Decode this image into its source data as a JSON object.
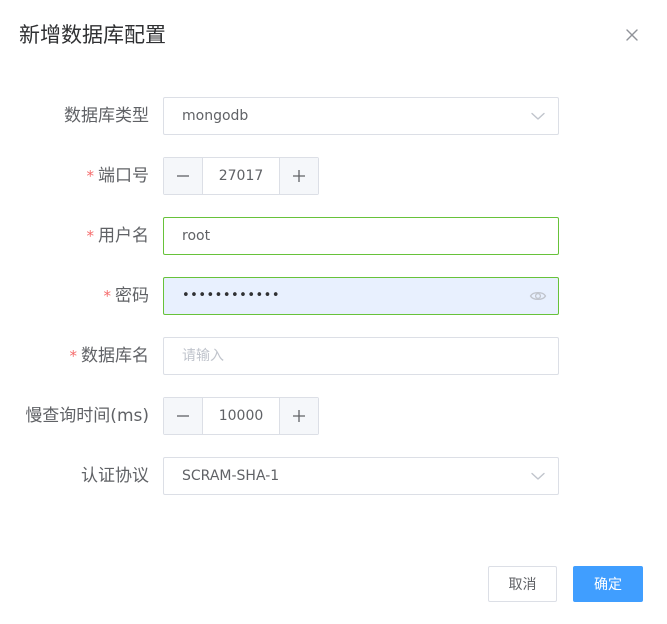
{
  "dialog": {
    "title": "新增数据库配置",
    "close_icon": "close-icon"
  },
  "form": {
    "db_type": {
      "label": "数据库类型",
      "required": false,
      "value": "mongodb",
      "icon": "chevron-down-icon"
    },
    "port": {
      "label": "端口号",
      "required": true,
      "value": "27017",
      "decrement_icon": "minus-icon",
      "increment_icon": "plus-icon"
    },
    "username": {
      "label": "用户名",
      "required": true,
      "value": "root"
    },
    "password": {
      "label": "密码",
      "required": true,
      "value": "••••••••••••",
      "icon": "eye-icon"
    },
    "db_name": {
      "label": "数据库名",
      "required": true,
      "value": "",
      "placeholder": "请输入"
    },
    "slow_query_time": {
      "label": "慢查询时间(ms)",
      "required": false,
      "value": "10000",
      "decrement_icon": "minus-icon",
      "increment_icon": "plus-icon"
    },
    "auth_protocol": {
      "label": "认证协议",
      "required": false,
      "value": "SCRAM-SHA-1",
      "icon": "chevron-down-icon"
    },
    "required_mark": "*"
  },
  "footer": {
    "cancel_label": "取消",
    "confirm_label": "确定"
  },
  "colors": {
    "primary": "#409eff",
    "success_border": "#67c23a",
    "required": "#f56c6c",
    "autofill_bg": "#e8f0fe"
  }
}
